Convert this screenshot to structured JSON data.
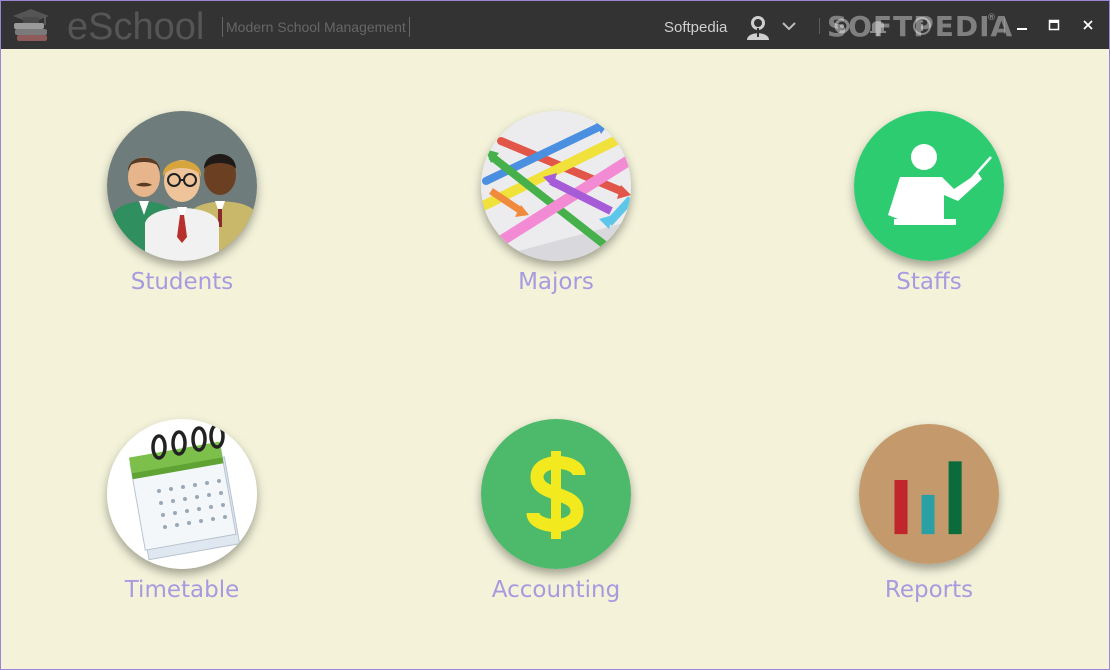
{
  "window": {
    "title": "eSchool",
    "subtitle": "Modern School Management",
    "user_name": "Softpedia",
    "watermark": "SOFTPEDIA",
    "watermark_reg": "®"
  },
  "titlebar_icons": [
    "graduation-books-logo",
    "user-avatar-icon",
    "chevron-down-icon",
    "settings-icon",
    "notification-bell-icon",
    "info-icon",
    "minimize-icon",
    "maximize-icon",
    "close-icon"
  ],
  "modules": [
    {
      "id": "students",
      "label": "Students",
      "color": "#6f7c7c"
    },
    {
      "id": "majors",
      "label": "Majors",
      "color": "#e8e8ea"
    },
    {
      "id": "staffs",
      "label": "Staffs",
      "color": "#2ecc71"
    },
    {
      "id": "timetable",
      "label": "Timetable",
      "color": "#ffffff"
    },
    {
      "id": "accounting",
      "label": "Accounting",
      "color": "#4cb96b"
    },
    {
      "id": "reports",
      "label": "Reports",
      "color": "#c49a6c"
    }
  ],
  "colors": {
    "background": "#f4f3da",
    "titlebar": "#333333",
    "label": "#a79be0",
    "window_border": "#9b86d6"
  }
}
